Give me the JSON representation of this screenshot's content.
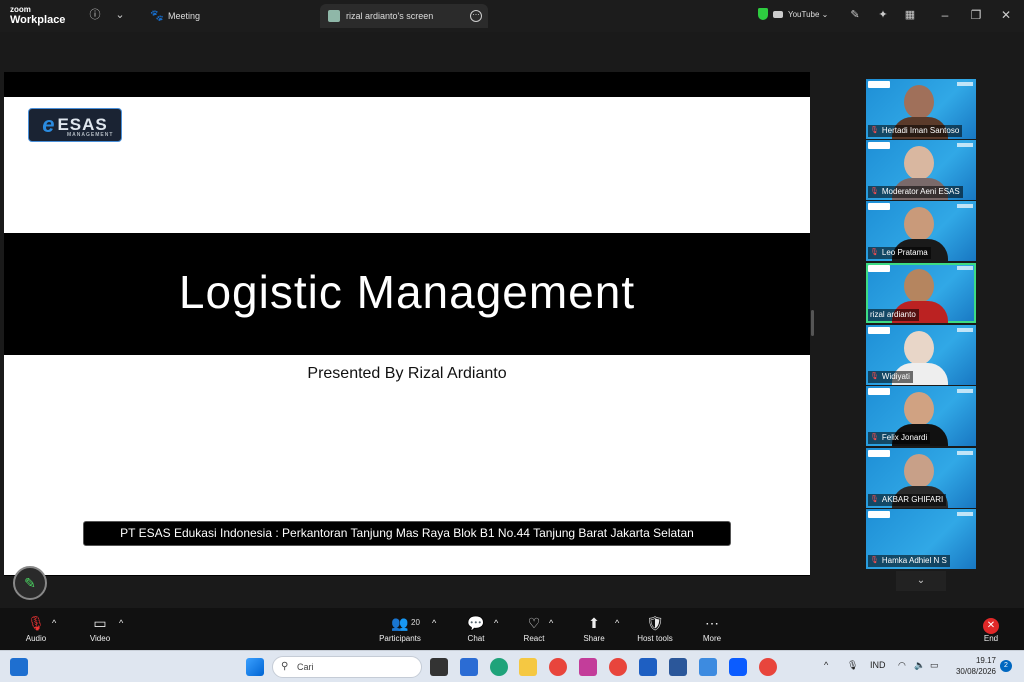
{
  "app": {
    "logo_line1": "zoom",
    "logo_line2": "Workplace"
  },
  "tabs": [
    {
      "label": "Meeting"
    },
    {
      "label": "rizal ardianto's screen"
    }
  ],
  "titlebar": {
    "youtube_label": "YouTube ⌄"
  },
  "slide": {
    "logo_text": "ESAS",
    "logo_sub": "MANAGEMENT",
    "title": "Logistic Management",
    "subtitle": "Presented By Rizal Ardianto",
    "footer": "PT ESAS Edukasi Indonesia : Perkantoran Tanjung Mas Raya Blok B1 No.44 Tanjung Barat Jakarta Selatan"
  },
  "participants": [
    {
      "name": "Hertadi Iman Santoso",
      "muted": true
    },
    {
      "name": "Moderator Aeni ESAS",
      "muted": true
    },
    {
      "name": "Leo Pratama",
      "muted": true
    },
    {
      "name": "rizal ardianto",
      "muted": false,
      "active": true
    },
    {
      "name": "Widiyati",
      "muted": true
    },
    {
      "name": "Felix Jonardi",
      "muted": true
    },
    {
      "name": "AKBAR GHIFARI",
      "muted": true
    },
    {
      "name": "Hamka Adhiel N S",
      "muted": true
    }
  ],
  "toolbar": {
    "audio": "Audio",
    "video": "Video",
    "participants": "Participants",
    "participants_count": "20",
    "chat": "Chat",
    "react": "React",
    "share": "Share",
    "host_tools": "Host tools",
    "more": "More",
    "end": "End"
  },
  "taskbar": {
    "search_placeholder": "Cari",
    "language": "IND",
    "time": "19.17",
    "date": "30/08/2026",
    "notifications": "2"
  }
}
